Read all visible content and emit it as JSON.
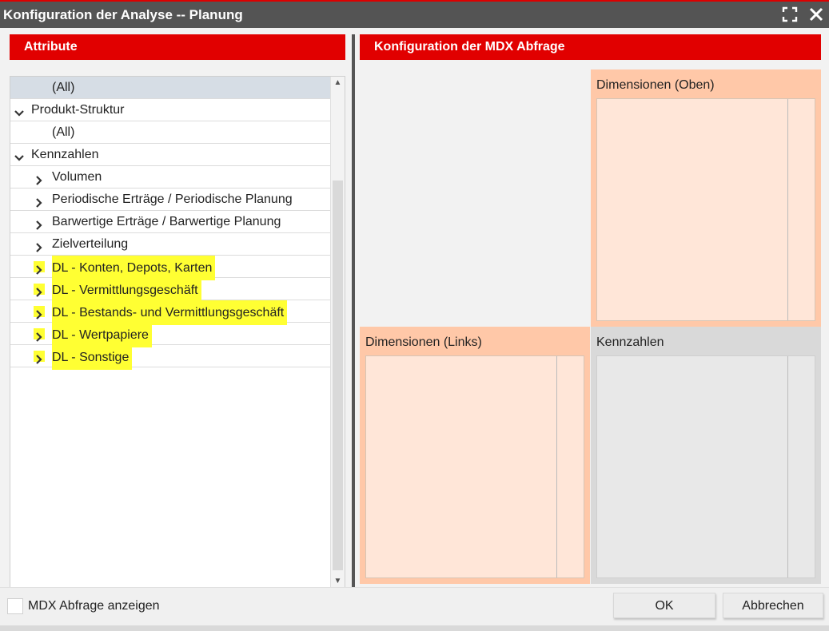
{
  "window": {
    "title": "Konfiguration der Analyse -- Planung",
    "maximize_icon": "maximize-icon",
    "close_icon": "close-icon"
  },
  "left_panel": {
    "header": "Attribute",
    "tree": [
      {
        "label": "(All)",
        "level": 2,
        "chevron": "none",
        "selected": true,
        "highlighted": false
      },
      {
        "label": "Produkt-Struktur",
        "level": 1,
        "chevron": "down",
        "selected": false,
        "highlighted": false
      },
      {
        "label": "(All)",
        "level": 2,
        "chevron": "none",
        "selected": false,
        "highlighted": false
      },
      {
        "label": "Kennzahlen",
        "level": 1,
        "chevron": "down",
        "selected": false,
        "highlighted": false
      },
      {
        "label": "Volumen",
        "level": 2,
        "chevron": "right",
        "selected": false,
        "highlighted": false
      },
      {
        "label": "Periodische Erträge / Periodische Planung",
        "level": 2,
        "chevron": "right",
        "selected": false,
        "highlighted": false
      },
      {
        "label": "Barwertige Erträge / Barwertige Planung",
        "level": 2,
        "chevron": "right",
        "selected": false,
        "highlighted": false
      },
      {
        "label": "Zielverteilung",
        "level": 2,
        "chevron": "right",
        "selected": false,
        "highlighted": false
      },
      {
        "label": "DL - Konten, Depots, Karten",
        "level": 2,
        "chevron": "right",
        "selected": false,
        "highlighted": true
      },
      {
        "label": "DL - Vermittlungsgeschäft",
        "level": 2,
        "chevron": "right",
        "selected": false,
        "highlighted": true
      },
      {
        "label": "DL - Bestands- und Vermittlungsgeschäft",
        "level": 2,
        "chevron": "right",
        "selected": false,
        "highlighted": true
      },
      {
        "label": "DL - Wertpapiere",
        "level": 2,
        "chevron": "right",
        "selected": false,
        "highlighted": true
      },
      {
        "label": "DL - Sonstige",
        "level": 2,
        "chevron": "right",
        "selected": false,
        "highlighted": true
      }
    ]
  },
  "right_panel": {
    "header": "Konfiguration der MDX Abfrage",
    "zones": {
      "top": "Dimensionen (Oben)",
      "left": "Dimensionen (Links)",
      "measures": "Kennzahlen"
    }
  },
  "footer": {
    "checkbox_label": "MDX Abfrage anzeigen",
    "checkbox_checked": false,
    "ok_label": "OK",
    "cancel_label": "Abbrechen"
  },
  "colors": {
    "accent": "#e10000",
    "highlight": "#ffff33",
    "dimension_zone": "#ffc8a8",
    "dimension_inner": "#ffe6d8",
    "measure_zone": "#d9d9d9"
  }
}
